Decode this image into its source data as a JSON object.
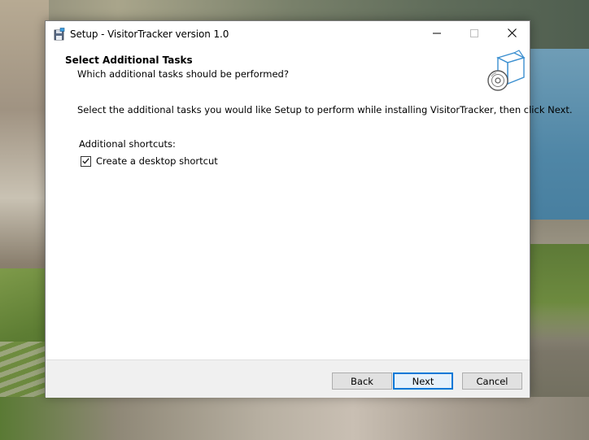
{
  "window": {
    "title": "Setup - VisitorTracker version 1.0",
    "icons": {
      "app": "installer-disk-icon",
      "minimize": "minimize-icon",
      "maximize": "maximize-icon",
      "close": "close-icon"
    }
  },
  "header": {
    "title": "Select Additional Tasks",
    "subtitle": "Which additional tasks should be performed?",
    "icon": "software-box-icon"
  },
  "body": {
    "instruction": "Select the additional tasks you would like Setup to perform while installing VisitorTracker, then click Next.",
    "group_label": "Additional shortcuts:",
    "tasks": [
      {
        "label": "Create a desktop shortcut",
        "checked": true
      }
    ]
  },
  "footer": {
    "back_label": "Back",
    "next_label": "Next",
    "cancel_label": "Cancel"
  },
  "colors": {
    "accent": "#0078d7",
    "footer_bg": "#f0f0f0",
    "button_bg": "#e1e1e1"
  }
}
